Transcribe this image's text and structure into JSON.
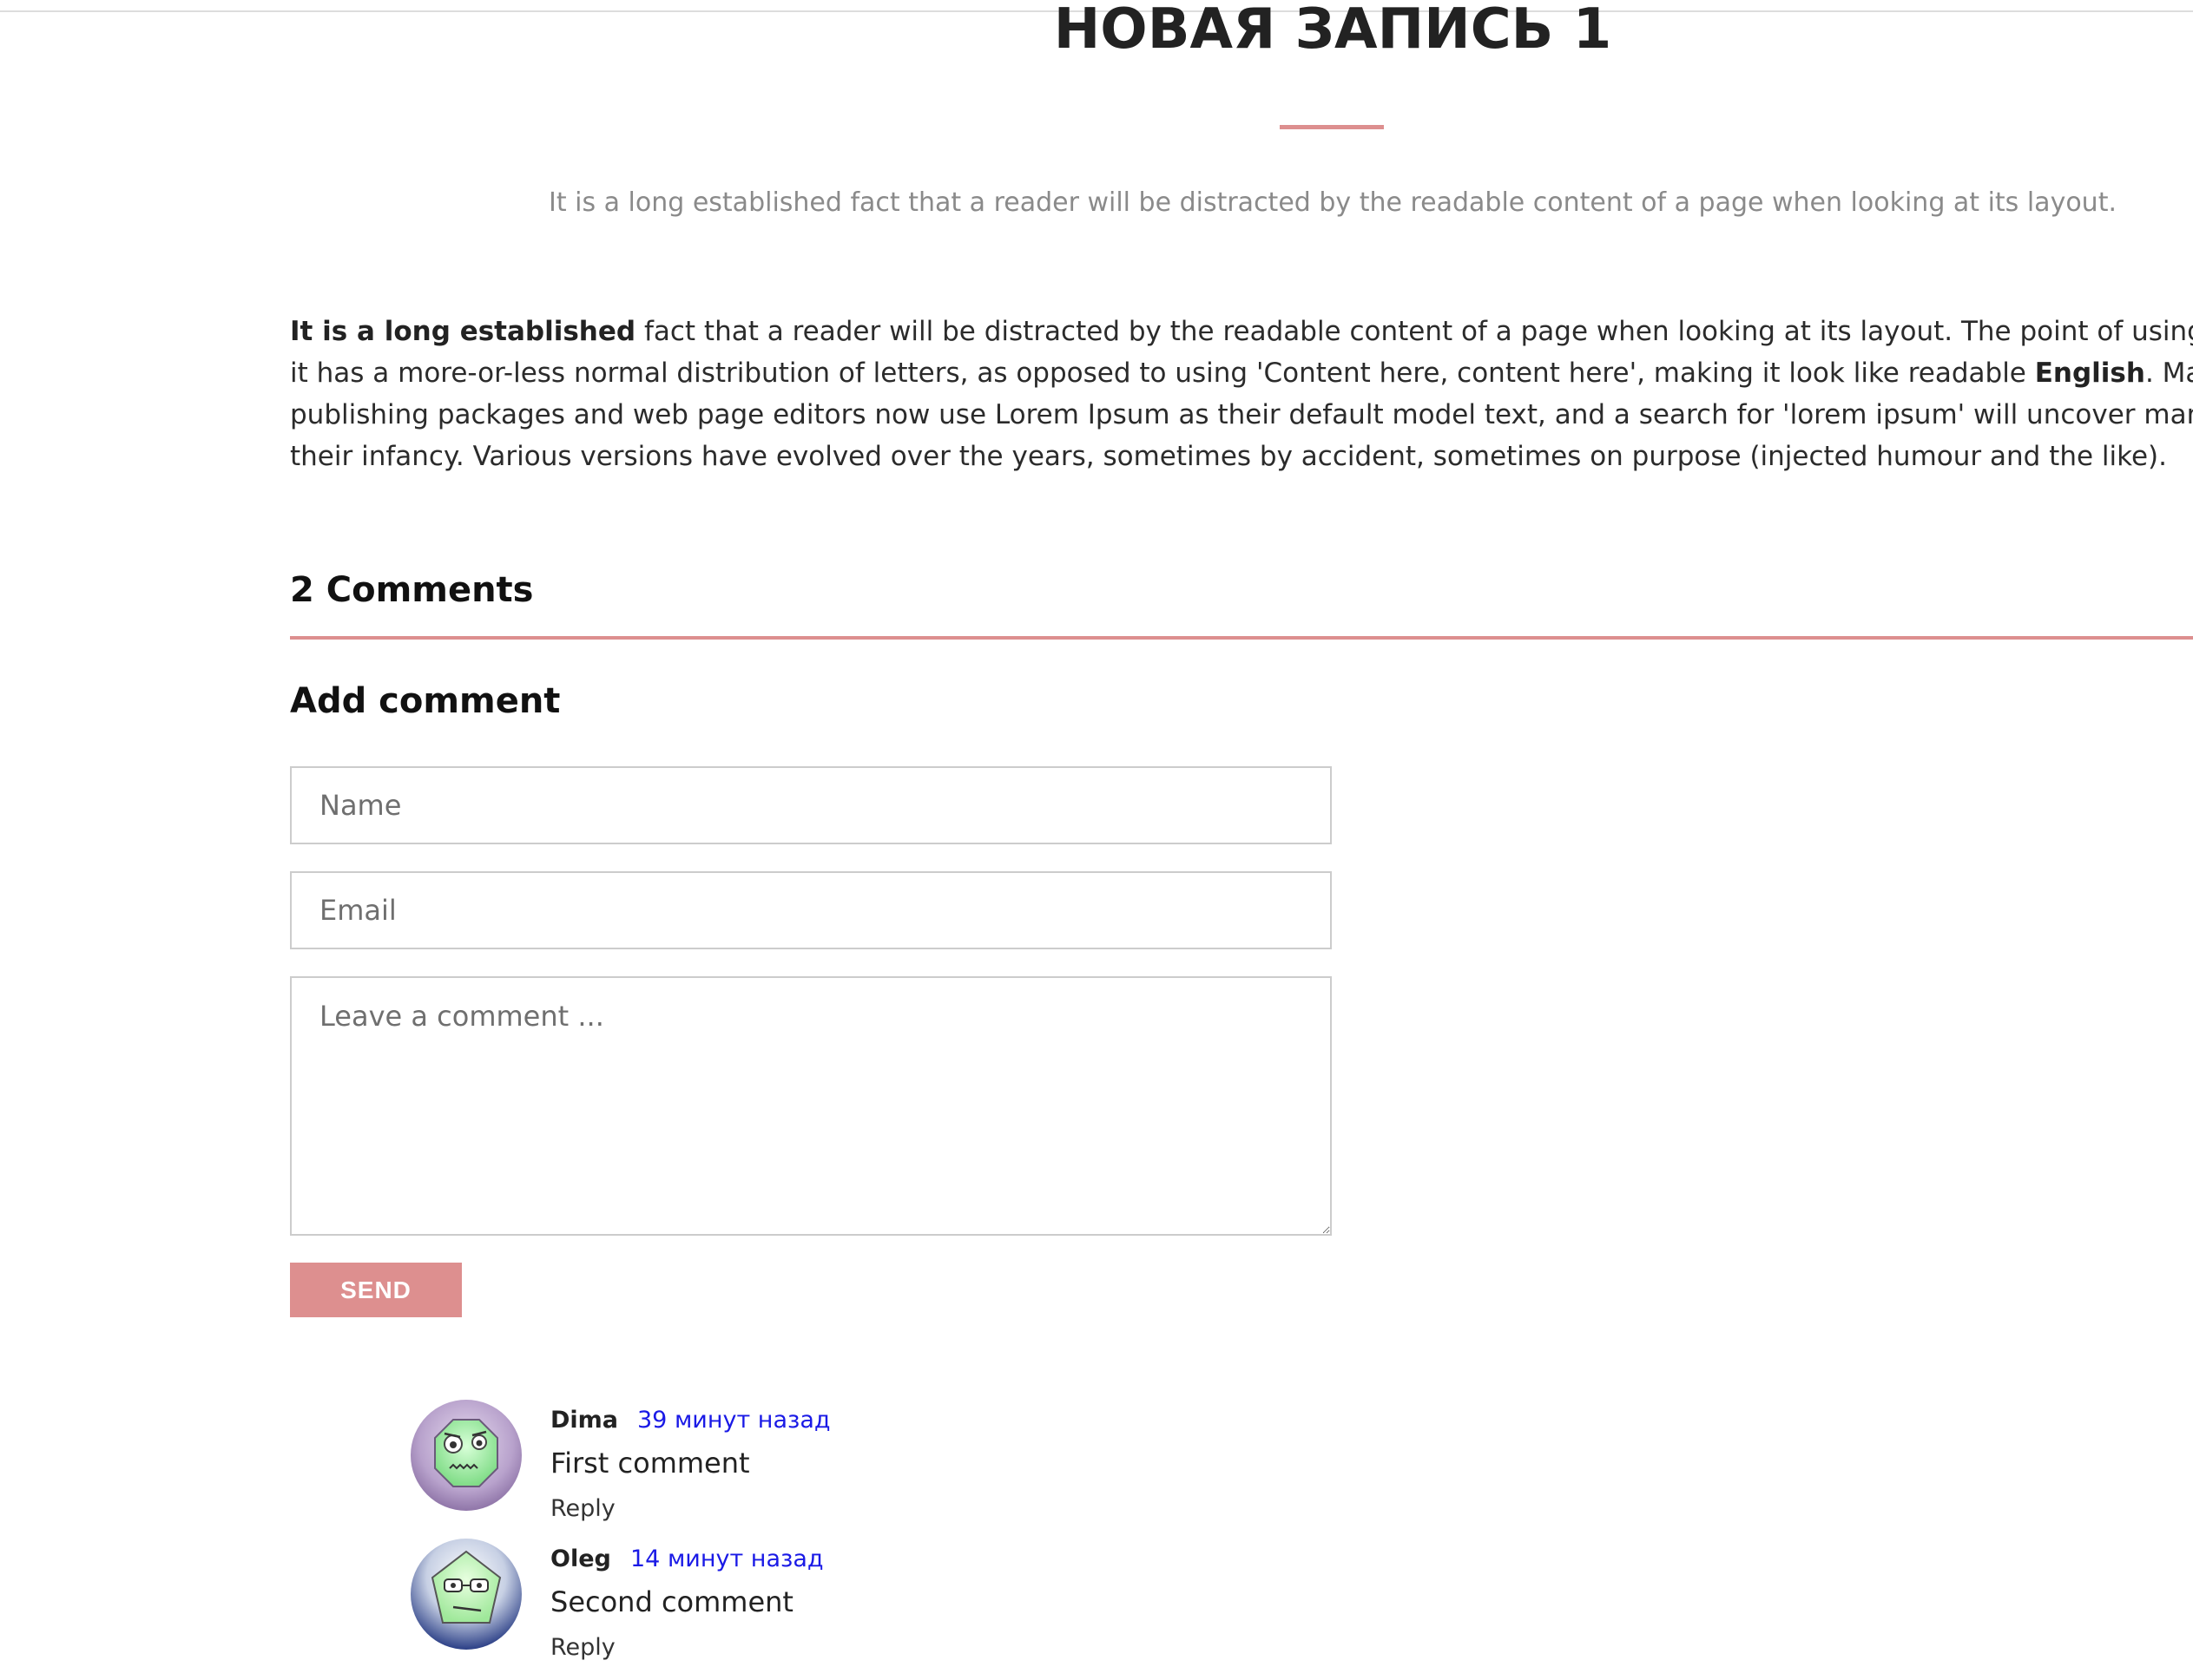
{
  "post": {
    "title": "НОВАЯ ЗАПИСЬ 1",
    "subtitle": "It is a long established fact that a reader will be distracted by the readable content of a page when looking at its layout.",
    "body": {
      "line1_bold": "It is a long established",
      "line1_rest": " fact that a reader will be distracted by the readable content of a page when looking at its layout. The point of using Lorem",
      "line2_start": "it has a more-or-less normal distribution of letters, as opposed to using 'Content here, content here', making it look like readable ",
      "line2_bold": "English",
      "line2_end": ". Many des",
      "line3": "publishing packages and web page editors now use Lorem Ipsum as their default model text, and a search for 'lorem ipsum' will uncover many we",
      "line4": "their infancy. Various versions have evolved over the years, sometimes by accident, sometimes on purpose (injected humour and the like)."
    }
  },
  "comments_section": {
    "count_label": "2 Comments",
    "form": {
      "heading": "Add comment",
      "name_placeholder": "Name",
      "email_placeholder": "Email",
      "comment_placeholder": "Leave a comment ...",
      "send_label": "SEND"
    },
    "comments": [
      {
        "author": "Dima",
        "time": "39 минут назад",
        "text": "First comment",
        "reply_label": "Reply",
        "avatar_icon": "octagon-face-avatar-icon"
      },
      {
        "author": "Oleg",
        "time": "14 минут назад",
        "text": "Second comment",
        "reply_label": "Reply",
        "avatar_icon": "pentagon-face-avatar-icon"
      }
    ]
  },
  "colors": {
    "accent": "#dd8f8f",
    "time_link": "#1a1ae6",
    "subtitle_gray": "#8a8a8a"
  }
}
